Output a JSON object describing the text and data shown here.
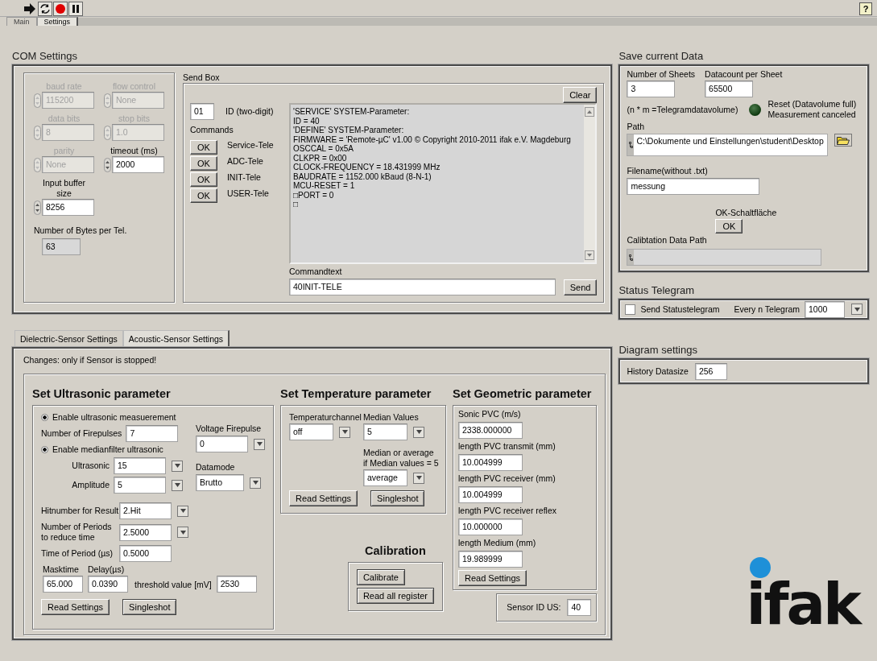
{
  "help_icon": "?",
  "tabs": [
    {
      "label": "Main",
      "selected": false
    },
    {
      "label": "Settings",
      "selected": true
    }
  ],
  "com": {
    "title": "COM Settings",
    "fields": [
      {
        "label": "baud rate",
        "value": "115200",
        "disabled": true
      },
      {
        "label": "flow control",
        "value": "None",
        "disabled": true
      },
      {
        "label": "data bits",
        "value": "8",
        "disabled": true
      },
      {
        "label": "stop bits",
        "value": "1.0",
        "disabled": true
      },
      {
        "label": "parity",
        "value": "None",
        "disabled": true
      },
      {
        "label": "timeout (ms)",
        "value": "2000",
        "disabled": false
      },
      {
        "label": "Input buffer size",
        "value": "8256",
        "disabled": false
      }
    ],
    "bytes": {
      "label": "Number of Bytes per Tel.",
      "value": "63"
    },
    "send_box": {
      "title": "Send Box",
      "clear": "Clear",
      "id": {
        "value": "01",
        "label": "ID (two-digit)"
      },
      "commands_label": "Commands",
      "commands": [
        {
          "button": "OK",
          "label": "Service-Tele"
        },
        {
          "button": "OK",
          "label": "ADC-Tele"
        },
        {
          "button": "OK",
          "label": "INIT-Tele"
        },
        {
          "button": "OK",
          "label": "USER-Tele"
        }
      ],
      "response_lines": [
        "'SERVICE' SYSTEM-Parameter:",
        "ID = 40",
        "'DEFINE' SYSTEM-Parameter:",
        "FIRMWARE = 'Remote-µC' v1.00 © Copyright 2010-2011 ifak e.V. Magdeburg",
        "OSCCAL = 0x5A",
        "CLKPR = 0x00",
        "CLOCK-FREQUENCY = 18.431999 MHz",
        "BAUDRATE = 1152.000 kBaud (8-N-1)",
        "MCU-RESET = 1",
        "□PORT = 0",
        "□"
      ],
      "commandtext": {
        "label": "Commandtext",
        "value": "40INIT-TELE"
      },
      "send": "Send"
    }
  },
  "save": {
    "title": "Save current Data",
    "sheets": {
      "label": "Number of Sheets",
      "value": "3"
    },
    "datacount": {
      "label": "Datacount per Sheet",
      "value": "65500"
    },
    "formula": "(n * m =Telegramdatavolume)",
    "reset_led": {
      "on": false,
      "lines": [
        "Reset (Datavolume full)",
        "Measurement canceled"
      ]
    },
    "path": {
      "label": "Path",
      "value": "C:\\Dokumente und Einstellungen\\student\\Desktop"
    },
    "filename": {
      "label": "Filename(without .txt)",
      "value": "messung"
    },
    "ok": {
      "label": "OK-Schaltfläche",
      "button": "OK"
    },
    "calib_path": {
      "label": "Calibtation Data Path"
    }
  },
  "status": {
    "title": "Status Telegram",
    "send": {
      "label": "Send Statustelegram",
      "checked": false
    },
    "every": {
      "label": "Every n Telegram",
      "value": "1000"
    }
  },
  "diagram": {
    "title": "Diagram settings",
    "history": {
      "label": "History Datasize",
      "value": "256"
    }
  },
  "sensor_tabs": [
    {
      "label": "Dielectric-Sensor Settings",
      "selected": false
    },
    {
      "label": "Acoustic-Sensor Settings",
      "selected": true
    }
  ],
  "notice": "Changes: only if Sensor is stopped!",
  "ultrasonic": {
    "title": "Set Ultrasonic parameter",
    "enable_measurement": {
      "label": "Enable ultrasonic measuerement",
      "on": true
    },
    "firepulses": {
      "label": "Number of Firepulses",
      "value": "7"
    },
    "enable_median": {
      "label": "Enable medianfilter ultrasonic",
      "on": true
    },
    "median_fields": [
      {
        "label": "Ultrasonic",
        "value": "15"
      },
      {
        "label": "Amplitude",
        "value": "5"
      }
    ],
    "voltage": {
      "label": "Voltage Firepulse",
      "value": "0"
    },
    "datamode": {
      "label": "Datamode",
      "value": "Brutto"
    },
    "hitnumber": {
      "label": "Hitnumber for Result",
      "value": "2.Hit"
    },
    "periods": {
      "label_lines": [
        "Number of Periods",
        "to reduce time"
      ],
      "value": "2.5000"
    },
    "period_time": {
      "label": "Time of Period (µs)",
      "value": "0.5000"
    },
    "masktime": {
      "label": "Masktime",
      "value": "65.000"
    },
    "delay": {
      "label": "Delay(µs)",
      "value": "0.0390"
    },
    "threshold": {
      "label": "threshold value [mV]",
      "value": "2530"
    },
    "read": "Read Settings",
    "singleshot": "Singleshot"
  },
  "temperature": {
    "title": "Set Temperature parameter",
    "channel": {
      "label": "Temperaturchannel",
      "value": "off"
    },
    "median": {
      "label": "Median Values",
      "value": "5"
    },
    "mode": {
      "label_lines": [
        "Median or average",
        "if Median values = 5"
      ],
      "value": "average"
    },
    "read": "Read Settings",
    "singleshot": "Singleshot"
  },
  "calibration": {
    "title": "Calibration",
    "buttons": [
      "Calibrate",
      "Read all register"
    ]
  },
  "geometric": {
    "title": "Set Geometric parameter",
    "fields": [
      {
        "label": "Sonic PVC (m/s)",
        "value": "2338.000000"
      },
      {
        "label": "length PVC transmit (mm)",
        "value": "10.004999"
      },
      {
        "label": "length PVC receiver (mm)",
        "value": "10.004999"
      },
      {
        "label": "length PVC receiver reflex",
        "value": "10.000000"
      },
      {
        "label": "length Medium (mm)",
        "value": "19.989999"
      }
    ],
    "read": "Read Settings"
  },
  "sensor_id": {
    "label": "Sensor ID US:",
    "value": "40"
  },
  "logo": {
    "text": "ifak"
  }
}
